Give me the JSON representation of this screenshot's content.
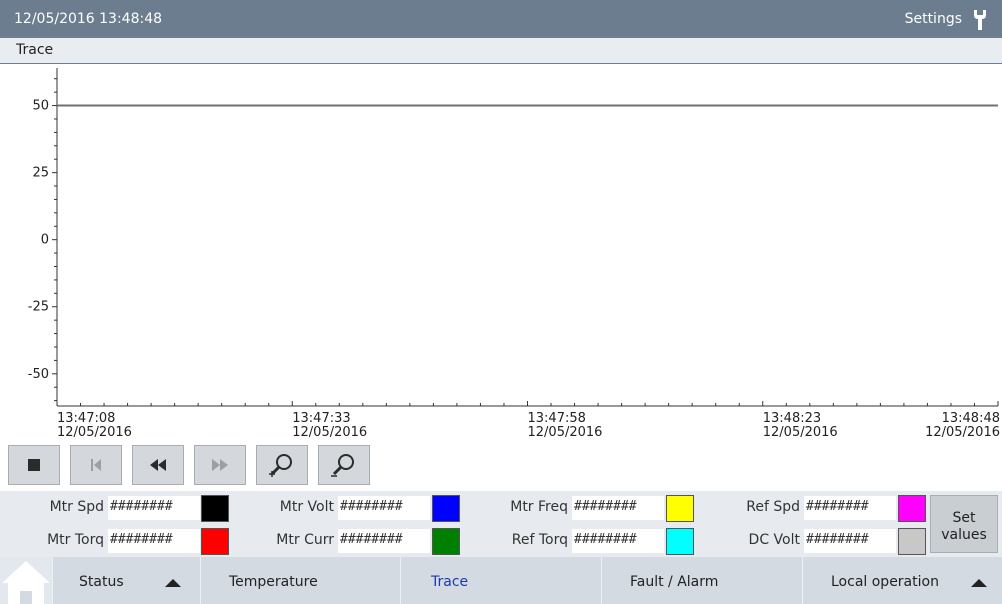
{
  "header": {
    "datetime": "12/05/2016 13:48:48",
    "settings_label": "Settings",
    "settings_icon": "wrench-icon"
  },
  "screen": {
    "title": "Trace"
  },
  "chart_data": {
    "type": "line",
    "y_ticks": [
      "50",
      "25",
      "0",
      "-25",
      "-50"
    ],
    "y_values": [
      50,
      25,
      0,
      -25,
      -50
    ],
    "ylim": [
      -62,
      64
    ],
    "x_ticks": [
      {
        "time": "13:47:08",
        "date": "12/05/2016"
      },
      {
        "time": "13:47:33",
        "date": "12/05/2016"
      },
      {
        "time": "13:47:58",
        "date": "12/05/2016"
      },
      {
        "time": "13:48:23",
        "date": "12/05/2016"
      },
      {
        "time": "13:48:48",
        "date": "12/05/2016"
      }
    ],
    "series": [
      {
        "values": [
          50,
          50,
          50,
          50,
          50
        ],
        "color": "#6f7275"
      }
    ],
    "grid": false
  },
  "controls": {
    "buttons": [
      {
        "name": "stop-button",
        "icon": "stop-icon",
        "enabled": true
      },
      {
        "name": "go-to-start-button",
        "icon": "skip-back-icon",
        "enabled": false
      },
      {
        "name": "rewind-button",
        "icon": "rewind-icon",
        "enabled": true
      },
      {
        "name": "forward-button",
        "icon": "fast-forward-icon",
        "enabled": false
      },
      {
        "name": "zoom-in-button",
        "icon": "zoom-in-icon",
        "enabled": true
      },
      {
        "name": "zoom-out-button",
        "icon": "zoom-out-icon",
        "enabled": true
      }
    ]
  },
  "signals": {
    "row1": [
      {
        "label": "Mtr Spd",
        "value": "########",
        "color": "#000000"
      },
      {
        "label": "Mtr Volt",
        "value": "########",
        "color": "#0000ff"
      },
      {
        "label": "Mtr Freq",
        "value": "########",
        "color": "#ffff00"
      },
      {
        "label": "Ref Spd",
        "value": "########",
        "color": "#ff00ff"
      }
    ],
    "row2": [
      {
        "label": "Mtr Torq",
        "value": "########",
        "color": "#ff0000"
      },
      {
        "label": "Mtr Curr",
        "value": "########",
        "color": "#008000"
      },
      {
        "label": "Ref Torq",
        "value": "########",
        "color": "#00ffff"
      },
      {
        "label": "DC Volt",
        "value": "########",
        "color": "#c8c8c8"
      }
    ],
    "set_values_line1": "Set",
    "set_values_line2": "values"
  },
  "nav": {
    "items": [
      {
        "label": "Status"
      },
      {
        "label": "Temperature"
      },
      {
        "label": "Trace",
        "active": true
      },
      {
        "label": "Fault / Alarm"
      },
      {
        "label": "Local operation"
      }
    ]
  }
}
